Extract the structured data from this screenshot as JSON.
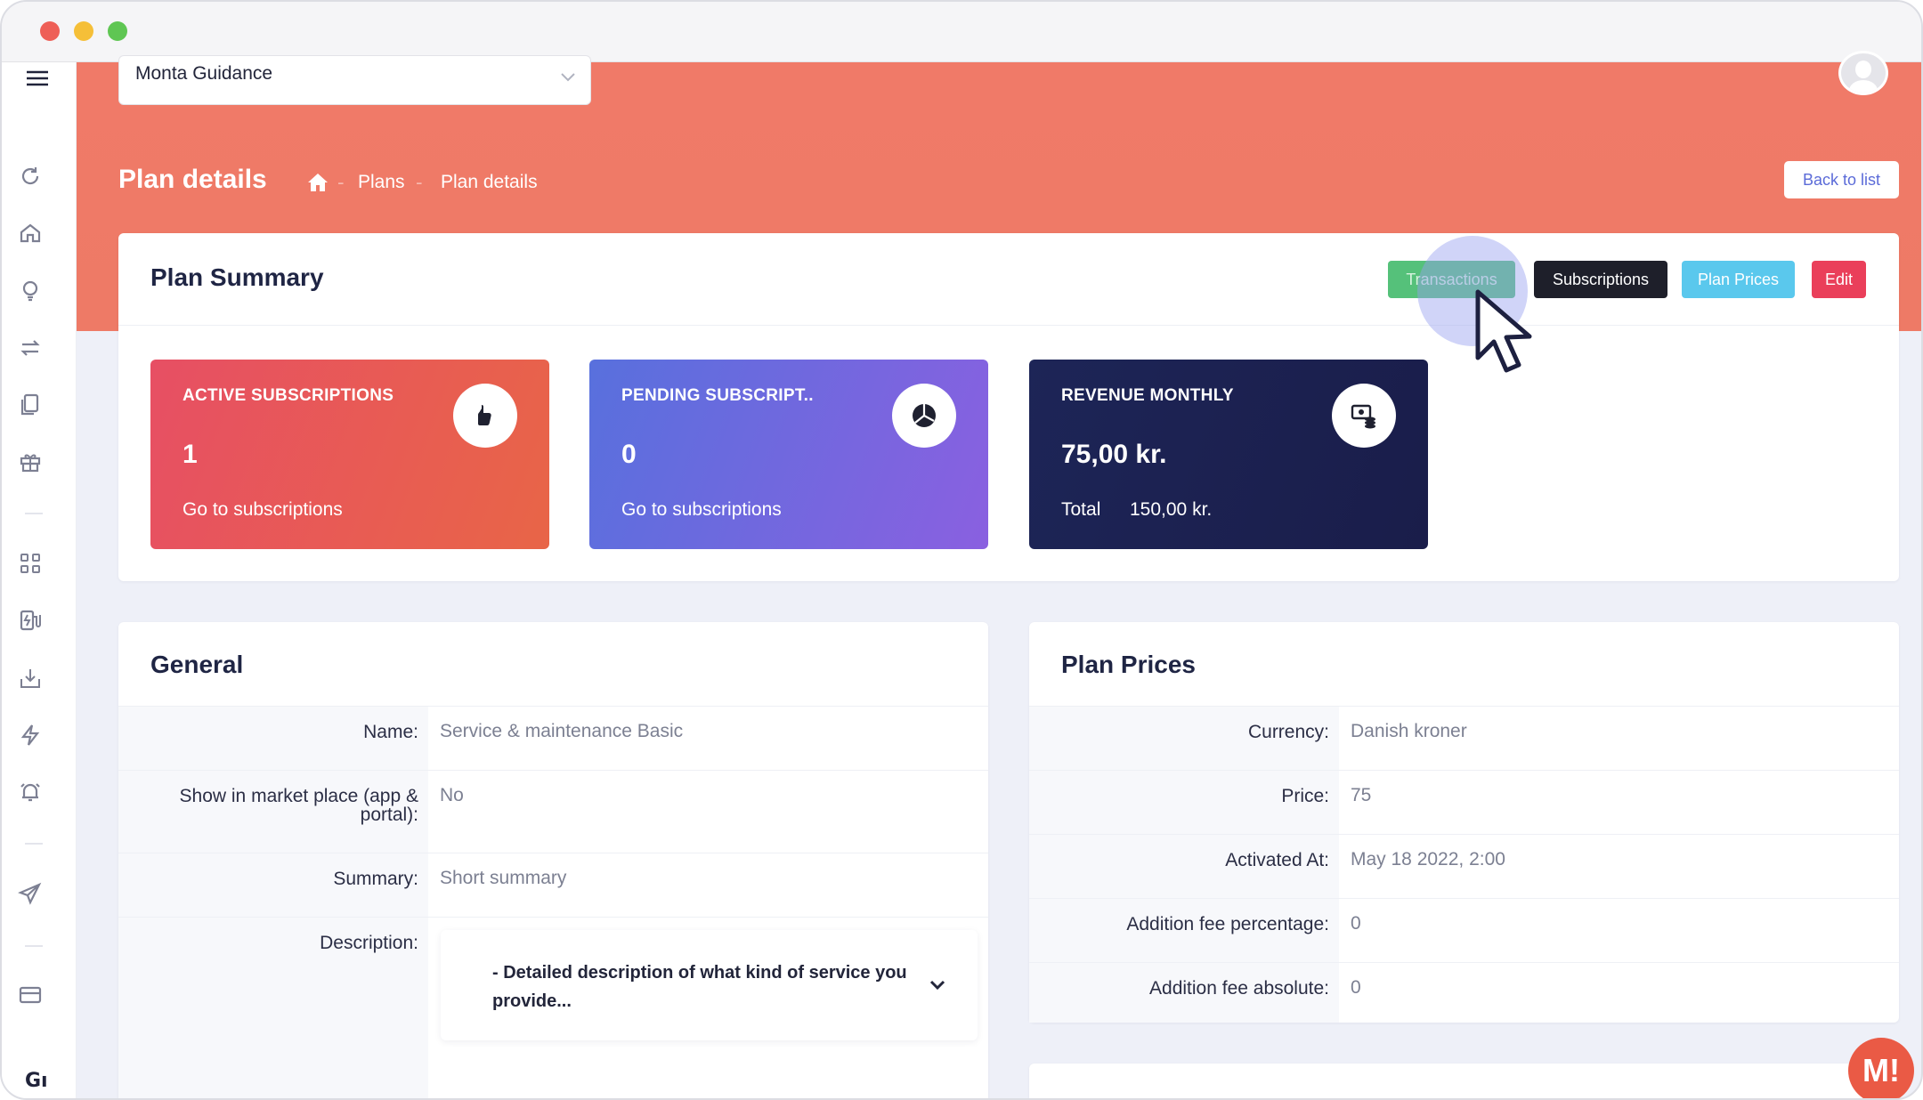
{
  "window": {
    "controls": [
      "close",
      "minimize",
      "maximize"
    ]
  },
  "org_selector": {
    "value": "Monta Guidance"
  },
  "header": {
    "title": "Plan details",
    "breadcrumb": {
      "home_icon": "home-icon",
      "items": [
        "Plans",
        "Plan details"
      ],
      "separator": "-"
    },
    "back_label": "Back to list"
  },
  "summary": {
    "title": "Plan Summary",
    "buttons": {
      "transactions": "Transactions",
      "subscriptions": "Subscriptions",
      "plan_prices": "Plan Prices",
      "edit": "Edit"
    },
    "stats": [
      {
        "label": "ACTIVE SUBSCRIPTIONS",
        "value": "1",
        "link": "Go to subscriptions",
        "icon": "thumb-up-icon"
      },
      {
        "label": "PENDING SUBSCRIPT..",
        "value": "0",
        "link": "Go to subscriptions",
        "icon": "pie-chart-icon"
      },
      {
        "label": "REVENUE MONTHLY",
        "value": "75,00 kr.",
        "total_label": "Total",
        "total_value": "150,00 kr.",
        "icon": "money-icon"
      }
    ]
  },
  "general": {
    "title": "General",
    "fields": [
      {
        "label": "Name:",
        "value": "Service & maintenance Basic"
      },
      {
        "label": "Show in market place (app & portal):",
        "value": "No"
      },
      {
        "label": "Summary:",
        "value": "Short summary"
      },
      {
        "label": "Description:",
        "value": "- Detailed description of what kind of service you provide..."
      }
    ]
  },
  "plan_prices": {
    "title": "Plan Prices",
    "fields": [
      {
        "label": "Currency:",
        "value": "Danish kroner"
      },
      {
        "label": "Price:",
        "value": "75"
      },
      {
        "label": "Activated At:",
        "value": "May 18 2022, 2:00"
      },
      {
        "label": "Addition fee percentage:",
        "value": "0"
      },
      {
        "label": "Addition fee absolute:",
        "value": "0"
      }
    ]
  },
  "sidebar": {
    "icons": [
      "menu-icon",
      "refresh-icon",
      "home-icon",
      "lightbulb-icon",
      "transfer-icon",
      "documents-icon",
      "gift-icon",
      "apps-icon",
      "charger-icon",
      "download-icon",
      "lightning-icon",
      "alarm-icon",
      "send-icon",
      "card-icon"
    ],
    "footer_text": "Gı"
  },
  "chat": {
    "label": "M!"
  },
  "colors": {
    "hero": "#ee7a66",
    "accent": "#5b6bd8",
    "transactions": "#55c17a",
    "subscriptions": "#1e1f2a",
    "plan_prices": "#5ac8ed",
    "edit": "#ea3f5a"
  }
}
